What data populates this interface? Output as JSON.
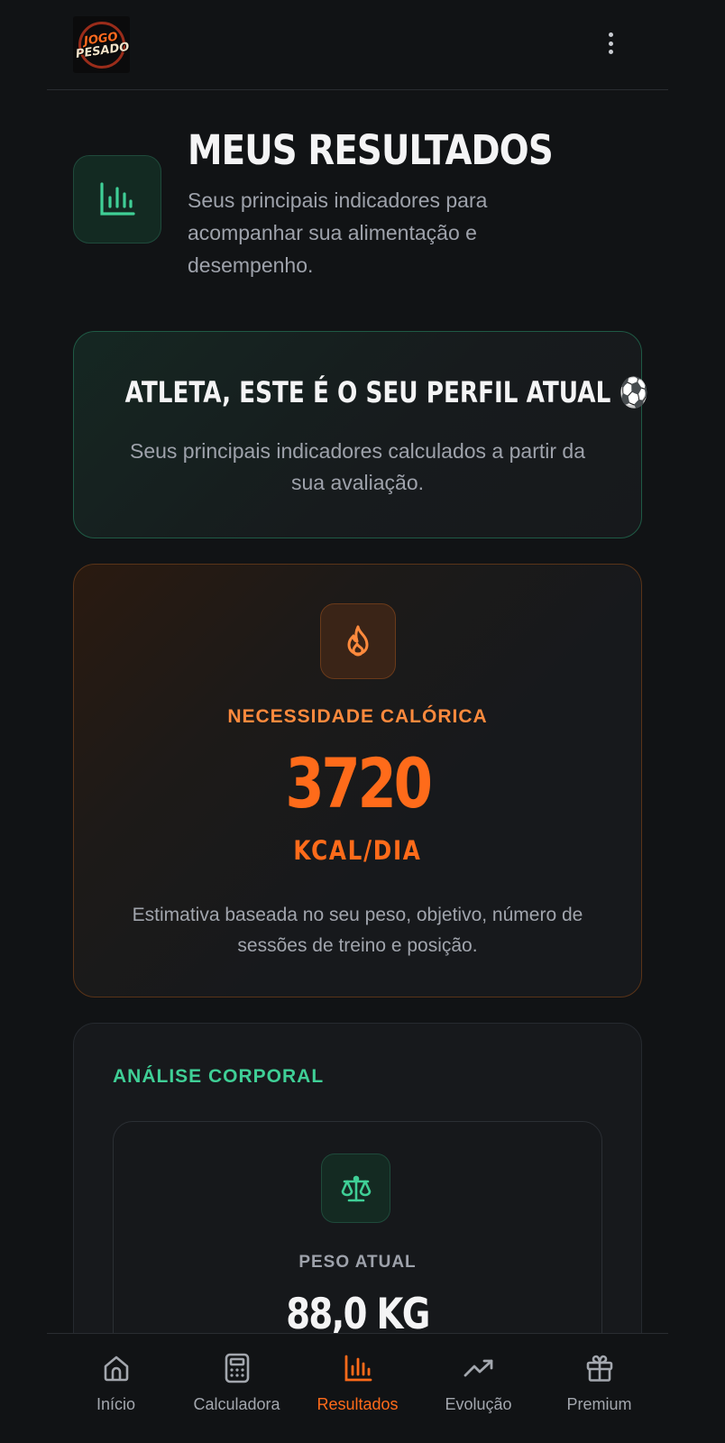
{
  "header": {
    "logo_top": "JOGO",
    "logo_bottom": "PESADO",
    "menu_icon": "more-vertical-icon"
  },
  "page": {
    "title": "MEUS RESULTADOS",
    "subtitle": "Seus principais indicadores para acompanhar sua alimentação e desempenho.",
    "icon": "bar-chart-icon"
  },
  "profile": {
    "title": "ATLETA, ESTE É O SEU PERFIL ATUAL ⚽",
    "subtitle": "Seus principais indicadores calculados a partir da sua avaliação."
  },
  "calories": {
    "icon": "flame-icon",
    "label": "NECESSIDADE CALÓRICA",
    "value": "3720",
    "unit": "KCAL/DIA",
    "description": "Estimativa baseada no seu peso, objetivo, número de sessões de treino e posição."
  },
  "body_analysis": {
    "section_label": "ANÁLISE CORPORAL",
    "weight": {
      "icon": "scale-icon",
      "label": "PESO ATUAL",
      "value": "88,0 KG"
    }
  },
  "nav": {
    "items": [
      {
        "label": "Início",
        "icon": "home-icon"
      },
      {
        "label": "Calculadora",
        "icon": "calculator-icon"
      },
      {
        "label": "Resultados",
        "icon": "bar-chart-icon",
        "active": true
      },
      {
        "label": "Evolução",
        "icon": "trending-up-icon"
      },
      {
        "label": "Premium",
        "icon": "gift-icon"
      }
    ]
  },
  "colors": {
    "background": "#111315",
    "accent_orange": "#ff6b1a",
    "accent_green": "#3fcf96",
    "muted_text": "#9ea2ab"
  }
}
